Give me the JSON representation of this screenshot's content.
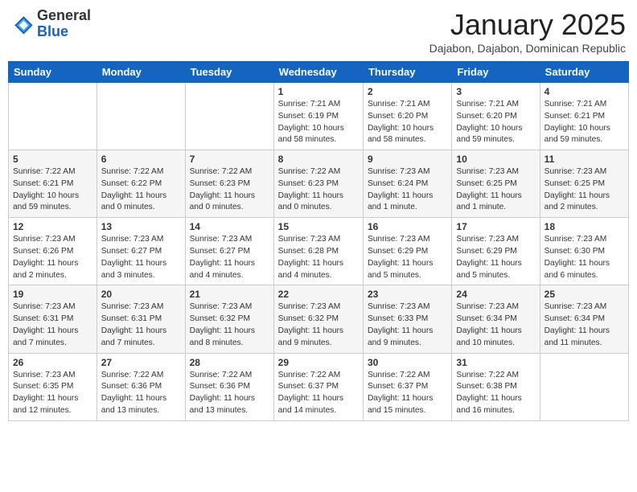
{
  "header": {
    "logo_general": "General",
    "logo_blue": "Blue",
    "month_title": "January 2025",
    "subtitle": "Dajabon, Dajabon, Dominican Republic"
  },
  "weekdays": [
    "Sunday",
    "Monday",
    "Tuesday",
    "Wednesday",
    "Thursday",
    "Friday",
    "Saturday"
  ],
  "weeks": [
    [
      {
        "day": "",
        "info": ""
      },
      {
        "day": "",
        "info": ""
      },
      {
        "day": "",
        "info": ""
      },
      {
        "day": "1",
        "info": "Sunrise: 7:21 AM\nSunset: 6:19 PM\nDaylight: 10 hours and 58 minutes."
      },
      {
        "day": "2",
        "info": "Sunrise: 7:21 AM\nSunset: 6:20 PM\nDaylight: 10 hours and 58 minutes."
      },
      {
        "day": "3",
        "info": "Sunrise: 7:21 AM\nSunset: 6:20 PM\nDaylight: 10 hours and 59 minutes."
      },
      {
        "day": "4",
        "info": "Sunrise: 7:21 AM\nSunset: 6:21 PM\nDaylight: 10 hours and 59 minutes."
      }
    ],
    [
      {
        "day": "5",
        "info": "Sunrise: 7:22 AM\nSunset: 6:21 PM\nDaylight: 10 hours and 59 minutes."
      },
      {
        "day": "6",
        "info": "Sunrise: 7:22 AM\nSunset: 6:22 PM\nDaylight: 11 hours and 0 minutes."
      },
      {
        "day": "7",
        "info": "Sunrise: 7:22 AM\nSunset: 6:23 PM\nDaylight: 11 hours and 0 minutes."
      },
      {
        "day": "8",
        "info": "Sunrise: 7:22 AM\nSunset: 6:23 PM\nDaylight: 11 hours and 0 minutes."
      },
      {
        "day": "9",
        "info": "Sunrise: 7:23 AM\nSunset: 6:24 PM\nDaylight: 11 hours and 1 minute."
      },
      {
        "day": "10",
        "info": "Sunrise: 7:23 AM\nSunset: 6:25 PM\nDaylight: 11 hours and 1 minute."
      },
      {
        "day": "11",
        "info": "Sunrise: 7:23 AM\nSunset: 6:25 PM\nDaylight: 11 hours and 2 minutes."
      }
    ],
    [
      {
        "day": "12",
        "info": "Sunrise: 7:23 AM\nSunset: 6:26 PM\nDaylight: 11 hours and 2 minutes."
      },
      {
        "day": "13",
        "info": "Sunrise: 7:23 AM\nSunset: 6:27 PM\nDaylight: 11 hours and 3 minutes."
      },
      {
        "day": "14",
        "info": "Sunrise: 7:23 AM\nSunset: 6:27 PM\nDaylight: 11 hours and 4 minutes."
      },
      {
        "day": "15",
        "info": "Sunrise: 7:23 AM\nSunset: 6:28 PM\nDaylight: 11 hours and 4 minutes."
      },
      {
        "day": "16",
        "info": "Sunrise: 7:23 AM\nSunset: 6:29 PM\nDaylight: 11 hours and 5 minutes."
      },
      {
        "day": "17",
        "info": "Sunrise: 7:23 AM\nSunset: 6:29 PM\nDaylight: 11 hours and 5 minutes."
      },
      {
        "day": "18",
        "info": "Sunrise: 7:23 AM\nSunset: 6:30 PM\nDaylight: 11 hours and 6 minutes."
      }
    ],
    [
      {
        "day": "19",
        "info": "Sunrise: 7:23 AM\nSunset: 6:31 PM\nDaylight: 11 hours and 7 minutes."
      },
      {
        "day": "20",
        "info": "Sunrise: 7:23 AM\nSunset: 6:31 PM\nDaylight: 11 hours and 7 minutes."
      },
      {
        "day": "21",
        "info": "Sunrise: 7:23 AM\nSunset: 6:32 PM\nDaylight: 11 hours and 8 minutes."
      },
      {
        "day": "22",
        "info": "Sunrise: 7:23 AM\nSunset: 6:32 PM\nDaylight: 11 hours and 9 minutes."
      },
      {
        "day": "23",
        "info": "Sunrise: 7:23 AM\nSunset: 6:33 PM\nDaylight: 11 hours and 9 minutes."
      },
      {
        "day": "24",
        "info": "Sunrise: 7:23 AM\nSunset: 6:34 PM\nDaylight: 11 hours and 10 minutes."
      },
      {
        "day": "25",
        "info": "Sunrise: 7:23 AM\nSunset: 6:34 PM\nDaylight: 11 hours and 11 minutes."
      }
    ],
    [
      {
        "day": "26",
        "info": "Sunrise: 7:23 AM\nSunset: 6:35 PM\nDaylight: 11 hours and 12 minutes."
      },
      {
        "day": "27",
        "info": "Sunrise: 7:22 AM\nSunset: 6:36 PM\nDaylight: 11 hours and 13 minutes."
      },
      {
        "day": "28",
        "info": "Sunrise: 7:22 AM\nSunset: 6:36 PM\nDaylight: 11 hours and 13 minutes."
      },
      {
        "day": "29",
        "info": "Sunrise: 7:22 AM\nSunset: 6:37 PM\nDaylight: 11 hours and 14 minutes."
      },
      {
        "day": "30",
        "info": "Sunrise: 7:22 AM\nSunset: 6:37 PM\nDaylight: 11 hours and 15 minutes."
      },
      {
        "day": "31",
        "info": "Sunrise: 7:22 AM\nSunset: 6:38 PM\nDaylight: 11 hours and 16 minutes."
      },
      {
        "day": "",
        "info": ""
      }
    ]
  ]
}
